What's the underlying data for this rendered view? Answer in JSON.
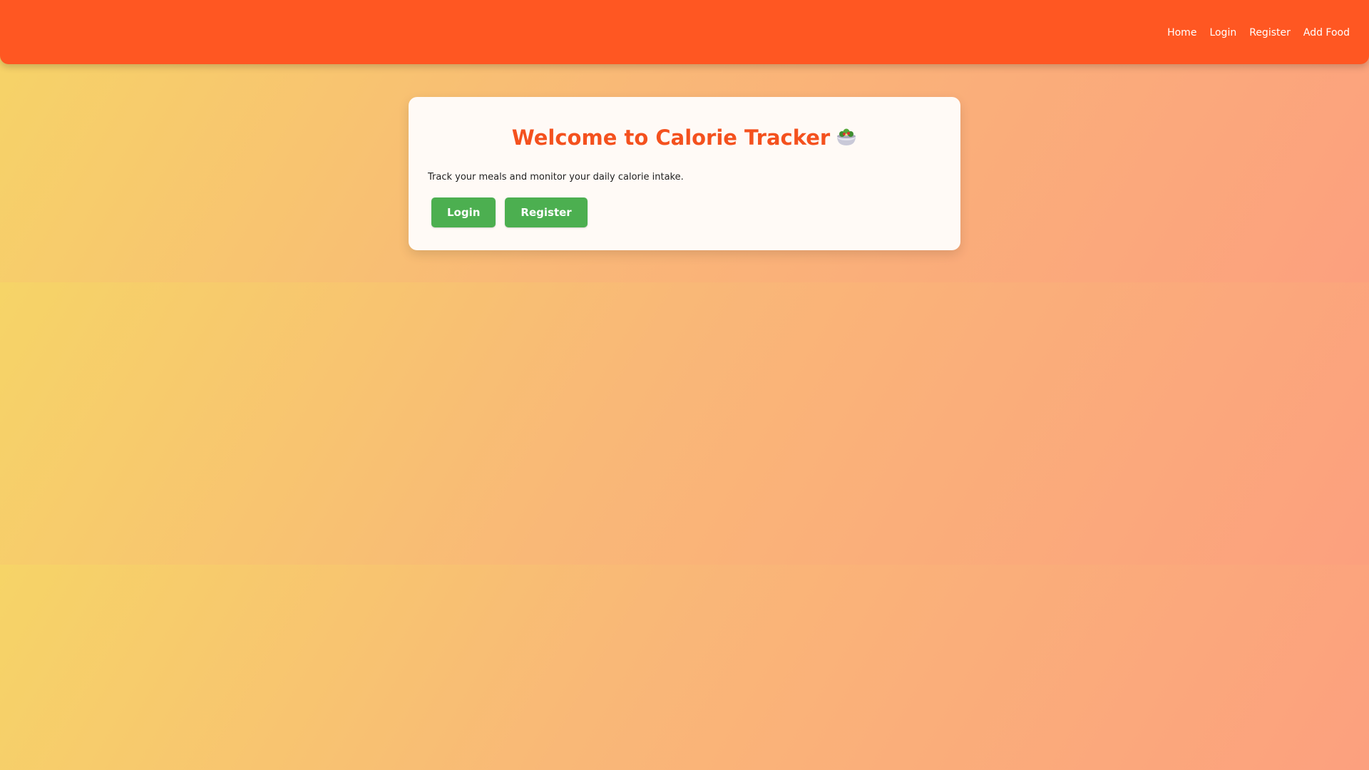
{
  "app": {
    "brand_color": "#ff5722",
    "button_color": "#4caf50"
  },
  "nav": {
    "links": [
      {
        "label": "Home"
      },
      {
        "label": "Login"
      },
      {
        "label": "Register"
      },
      {
        "label": "Add Food"
      }
    ]
  },
  "card": {
    "title": "Welcome to Calorie Tracker",
    "title_icon": "salad-bowl-icon",
    "description": "Track your meals and monitor your daily calorie intake.",
    "buttons": {
      "login": "Login",
      "register": "Register"
    }
  }
}
